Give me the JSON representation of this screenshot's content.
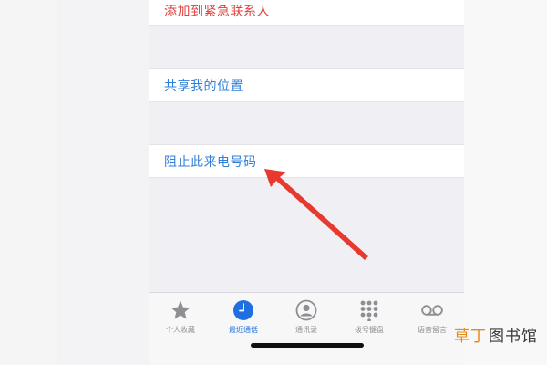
{
  "rows": {
    "add_emergency": "添加到紧急联系人",
    "share_location": "共享我的位置",
    "block_caller": "阻止此来电号码"
  },
  "tabbar": {
    "tabs": [
      {
        "label": "个人收藏",
        "icon": "star-icon"
      },
      {
        "label": "最近通话",
        "icon": "clock-icon",
        "active": true
      },
      {
        "label": "通讯录",
        "icon": "contact-icon"
      },
      {
        "label": "拨号键盘",
        "icon": "keypad-icon"
      },
      {
        "label": "语音留言",
        "icon": "voicemail-icon"
      }
    ]
  },
  "annotation": {
    "arrow_color": "#e8392f"
  },
  "watermark": {
    "part1": "草丁",
    "part2": "图书馆"
  },
  "colors": {
    "accent": "#1f6fe0",
    "destructive": "#e0403c",
    "link": "#2f7fd8"
  }
}
